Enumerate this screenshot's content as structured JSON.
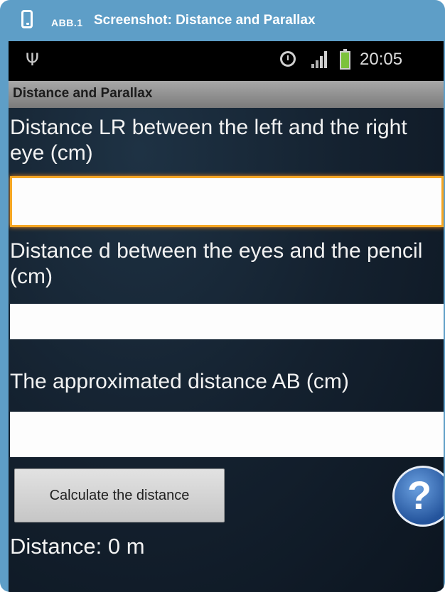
{
  "caption": {
    "abb": "ABB.1",
    "title": "Screenshot: Distance and Parallax",
    "icon": "phone-icon"
  },
  "statusbar": {
    "icons": [
      "usb-icon",
      "alarm-icon",
      "signal-icon",
      "battery-icon"
    ],
    "time": "20:05"
  },
  "appbar": {
    "title": "Distance and Parallax"
  },
  "form": {
    "lr_label": "Distance LR between the left and the right eye (cm)",
    "lr_value": "",
    "d_label": "Distance d between the eyes and the pencil (cm)",
    "d_value": "",
    "ab_label": "The approximated distance AB (cm)",
    "ab_value": ""
  },
  "actions": {
    "calculate_label": "Calculate the distance",
    "help_label": "?"
  },
  "result": {
    "text": "Distance: 0 m"
  },
  "colors": {
    "frame": "#5e9ec7",
    "focus_border": "#f5a623",
    "battery": "#7cc23c",
    "help_button": "#24549c"
  }
}
